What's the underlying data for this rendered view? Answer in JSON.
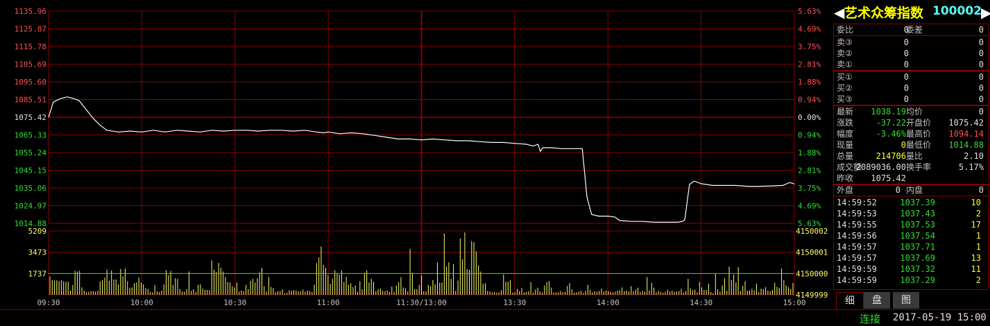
{
  "panel": {
    "name": "艺术众筹指数",
    "code": "100002",
    "weibi": {
      "label": "委比",
      "value": "0"
    },
    "weicha": {
      "label": "委差",
      "value": "0"
    },
    "sells": [
      {
        "label": "卖③",
        "price": "0",
        "vol": "0"
      },
      {
        "label": "卖②",
        "price": "0",
        "vol": "0"
      },
      {
        "label": "卖①",
        "price": "0",
        "vol": "0"
      }
    ],
    "buys": [
      {
        "label": "买①",
        "price": "0",
        "vol": "0"
      },
      {
        "label": "买②",
        "price": "0",
        "vol": "0"
      },
      {
        "label": "买③",
        "price": "0",
        "vol": "0"
      }
    ],
    "stats": {
      "latest": {
        "label": "最新",
        "value": "1038.19"
      },
      "avg": {
        "label": "均价",
        "value": "0"
      },
      "change": {
        "label": "涨跌",
        "value": "-37.22"
      },
      "open": {
        "label": "开盘价",
        "value": "1075.42"
      },
      "pct": {
        "label": "幅度",
        "value": "-3.46%"
      },
      "high": {
        "label": "最高价",
        "value": "1094.14"
      },
      "curvol": {
        "label": "现量",
        "value": "0"
      },
      "low": {
        "label": "最低价",
        "value": "1014.88"
      },
      "totvol": {
        "label": "总量",
        "value": "214706"
      },
      "ratio": {
        "label": "量比",
        "value": "2.10"
      },
      "amount": {
        "label": "成交额",
        "value": "2089036.00"
      },
      "turnover": {
        "label": "换手率",
        "value": "5.17%"
      },
      "prevclose": {
        "label": "昨收",
        "value": "1075.42"
      }
    },
    "outer": {
      "label": "外盘",
      "value": "0"
    },
    "inner": {
      "label": "内盘",
      "value": "0"
    },
    "ticks": [
      {
        "time": "14:59:52",
        "price": "1037.39",
        "vol": "10"
      },
      {
        "time": "14:59:53",
        "price": "1037.43",
        "vol": "2"
      },
      {
        "time": "14:59:55",
        "price": "1037.53",
        "vol": "17"
      },
      {
        "time": "14:59:56",
        "price": "1037.54",
        "vol": "1"
      },
      {
        "time": "14:59:57",
        "price": "1037.71",
        "vol": "1"
      },
      {
        "time": "14:59:57",
        "price": "1037.69",
        "vol": "13"
      },
      {
        "time": "14:59:59",
        "price": "1037.32",
        "vol": "11"
      },
      {
        "time": "14:59:59",
        "price": "1037.29",
        "vol": "2"
      }
    ],
    "tabs": [
      "细",
      "盘",
      "图"
    ]
  },
  "status": {
    "connection": "连接",
    "datetime": "2017-05-19 15:00"
  },
  "colors": {
    "grid": "#8b0000",
    "up": "#ff5050",
    "down": "#33dd33",
    "line": "#ffffff",
    "bar": "#ffff66",
    "level": "#33dd33"
  },
  "chart_data": {
    "type": "line",
    "price_axis": {
      "ticks": [
        "1135.96",
        "1125.87",
        "1115.78",
        "1105.69",
        "1095.60",
        "1085.51",
        "1075.42",
        "1065.33",
        "1055.24",
        "1045.15",
        "1035.06",
        "1024.97",
        "1014.88"
      ],
      "pct_ticks": [
        "5.63%",
        "4.69%",
        "3.75%",
        "2.81%",
        "1.88%",
        "0.94%",
        "0.00%",
        "0.94%",
        "1.88%",
        "2.81%",
        "3.75%",
        "4.69%",
        "5.63%"
      ],
      "ylim": [
        1014.88,
        1135.96
      ],
      "prev_close": 1075.42
    },
    "volume_axis": {
      "ticks": [
        "5209",
        "3473",
        "1737"
      ],
      "right_ticks": [
        "4150002",
        "4150001",
        "4150000",
        "4149999"
      ],
      "ylim": [
        0,
        5209
      ],
      "level": 1737
    },
    "x_labels": [
      "09:30",
      "10:00",
      "10:30",
      "11:00",
      "11:30/13:00",
      "13:30",
      "14:00",
      "14:30",
      "15:00"
    ],
    "price_series": [
      [
        0,
        1075.4
      ],
      [
        2,
        1084
      ],
      [
        5,
        1086
      ],
      [
        8,
        1087
      ],
      [
        11,
        1086
      ],
      [
        13,
        1085
      ],
      [
        16,
        1080
      ],
      [
        19,
        1075
      ],
      [
        22,
        1071
      ],
      [
        25,
        1068
      ],
      [
        30,
        1067
      ],
      [
        35,
        1067.5
      ],
      [
        40,
        1067
      ],
      [
        45,
        1068
      ],
      [
        50,
        1067
      ],
      [
        55,
        1068
      ],
      [
        60,
        1067.5
      ],
      [
        65,
        1067
      ],
      [
        70,
        1068
      ],
      [
        75,
        1067.5
      ],
      [
        80,
        1068
      ],
      [
        85,
        1068
      ],
      [
        90,
        1067.5
      ],
      [
        95,
        1068
      ],
      [
        100,
        1068
      ],
      [
        105,
        1067.5
      ],
      [
        110,
        1068
      ],
      [
        115,
        1067
      ],
      [
        118,
        1066.5
      ],
      [
        120,
        1067
      ],
      [
        125,
        1066
      ],
      [
        130,
        1066.5
      ],
      [
        135,
        1066
      ],
      [
        140,
        1065
      ],
      [
        145,
        1064
      ],
      [
        150,
        1063
      ],
      [
        155,
        1063
      ],
      [
        160,
        1062.5
      ],
      [
        165,
        1063
      ],
      [
        170,
        1062.5
      ],
      [
        175,
        1062
      ],
      [
        180,
        1062
      ],
      [
        185,
        1061.5
      ],
      [
        190,
        1061
      ],
      [
        195,
        1061
      ],
      [
        200,
        1060.5
      ],
      [
        205,
        1060
      ],
      [
        208,
        1059
      ],
      [
        210,
        1060
      ],
      [
        211,
        1056
      ],
      [
        212,
        1058
      ],
      [
        216,
        1058
      ],
      [
        220,
        1057.5
      ],
      [
        225,
        1057.5
      ],
      [
        229,
        1057.5
      ],
      [
        231,
        1030
      ],
      [
        233,
        1020
      ],
      [
        236,
        1019
      ],
      [
        240,
        1019
      ],
      [
        243,
        1018.5
      ],
      [
        245,
        1016.5
      ],
      [
        250,
        1016
      ],
      [
        255,
        1016
      ],
      [
        260,
        1015.5
      ],
      [
        265,
        1015.5
      ],
      [
        270,
        1015.5
      ],
      [
        272,
        1016
      ],
      [
        273,
        1017
      ],
      [
        275,
        1037
      ],
      [
        277,
        1039
      ],
      [
        280,
        1037.5
      ],
      [
        285,
        1036.5
      ],
      [
        290,
        1036.5
      ],
      [
        295,
        1036.5
      ],
      [
        300,
        1036
      ],
      [
        305,
        1036
      ],
      [
        310,
        1036.2
      ],
      [
        315,
        1036.5
      ],
      [
        318,
        1038.2
      ],
      [
        320,
        1037.3
      ]
    ],
    "volume_bars": [
      1500,
      1200,
      1150,
      1180,
      1120,
      1200,
      1100,
      1050,
      1070,
      350,
      800,
      1950,
      1900,
      1950,
      600,
      350,
      200,
      250,
      300,
      300,
      260,
      340,
      1100,
      1200,
      1400,
      2050,
      1150,
      1980,
      1250,
      1250,
      850,
      2100,
      1500,
      2150,
      1100,
      580,
      600,
      950,
      1000,
      1400,
      1000,
      850,
      550,
      470,
      250,
      200,
      800,
      280,
      230,
      340,
      850,
      2000,
      1600,
      1950,
      800,
      1350,
      1300,
      480,
      270,
      250,
      470,
      1900,
      320,
      450,
      220,
      820,
      850,
      500,
      410,
      400,
      380,
      2800,
      2050,
      1850,
      2600,
      2200,
      1900,
      1450,
      1050,
      990,
      700,
      600,
      1000,
      260,
      350,
      300,
      800,
      460,
      1150,
      1300,
      1000,
      1350,
      1850,
      2200,
      700,
      270,
      1450,
      640,
      560,
      210,
      290,
      310,
      460,
      120,
      170,
      380,
      320,
      380,
      350,
      270,
      280,
      420,
      250,
      350,
      300,
      240,
      820,
      2600,
      3050,
      3950,
      2450,
      2200,
      1600,
      900,
      1300,
      2000,
      1780,
      1640,
      1980,
      1040,
      1480,
      820,
      930,
      620,
      760,
      230,
      1100,
      450,
      1800,
      2000,
      1000,
      1300,
      1050,
      310,
      450,
      520,
      320,
      300,
      360,
      230,
      670,
      240,
      750,
      1040,
      1450,
      600,
      540,
      280,
      3750,
      1800,
      470,
      460,
      820,
      1580,
      280,
      290,
      800,
      700,
      1200,
      850,
      2650,
      990,
      1000,
      5000,
      2300,
      2650,
      1300,
      2500,
      330,
      1170,
      4600,
      2900,
      5090,
      2100,
      2050,
      4380,
      4300,
      3550,
      2400,
      1900,
      900,
      950,
      320,
      280,
      190,
      220,
      190,
      200,
      380,
      1650,
      1050,
      1070,
      1200,
      180,
      210,
      480,
      310,
      560,
      200,
      230,
      290,
      1030,
      180,
      410,
      580,
      270,
      190,
      750,
      1050,
      1120,
      590,
      180,
      200,
      200,
      300,
      210,
      240,
      720,
      960,
      450,
      180,
      200,
      270,
      330,
      150,
      320,
      820,
      400,
      200,
      280,
      260,
      320,
      520,
      280,
      360,
      300,
      240,
      200,
      260,
      340,
      380,
      600,
      300,
      350,
      260,
      700,
      280,
      420,
      580,
      230,
      320,
      250,
      1450,
      350,
      980,
      580,
      200,
      320,
      230,
      180,
      250,
      400,
      270,
      340,
      220,
      260,
      300,
      500,
      180,
      300,
      1300,
      530,
      370,
      420,
      200,
      1050,
      600,
      400,
      370,
      900,
      230,
      150,
      1700,
      450,
      260,
      760,
      1350,
      330,
      2300,
      1200,
      1650,
      1000,
      2250,
      300,
      740,
      1100,
      340,
      360,
      500,
      350,
      900,
      210,
      500,
      460,
      620,
      350,
      300,
      390,
      980,
      650,
      560,
      2160,
      1200,
      760,
      620,
      480,
      960
    ]
  }
}
